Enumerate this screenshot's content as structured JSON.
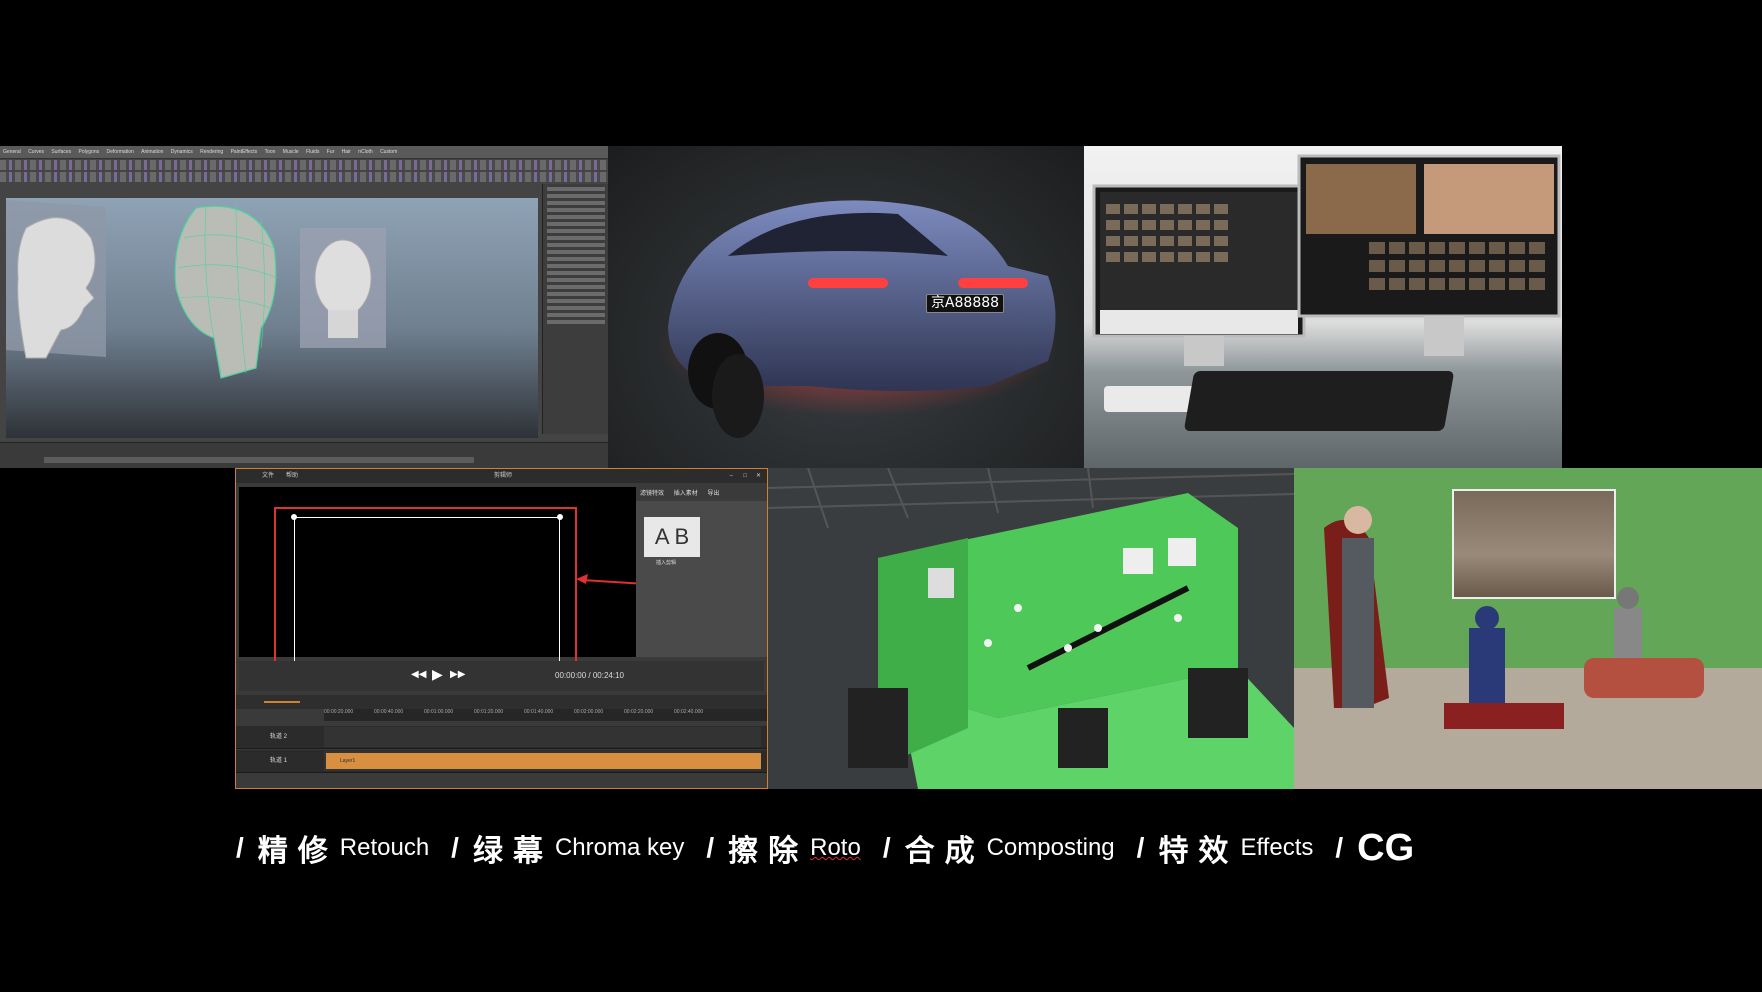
{
  "tiles": {
    "modeling": {
      "menubar": [
        "General",
        "Curves",
        "Surfaces",
        "Polygons",
        "Deformation",
        "Animation",
        "Dynamics",
        "Rendering",
        "PaintEffects",
        "Toon",
        "Muscle",
        "Fluids",
        "Fur",
        "Hair",
        "nCloth",
        "Custom"
      ]
    },
    "car": {
      "plate": "京A88888"
    },
    "editor": {
      "menu": [
        "文件",
        "帮助"
      ],
      "window_title": "剪辑师",
      "tabs": [
        "滤镜特效",
        "插入素材",
        "导出"
      ],
      "ab_label": "A B",
      "ab_caption": "插入剪辑",
      "timecode": "00:00:00 / 00:24:10",
      "ruler": [
        "00:00:20.000",
        "00:00:40.000",
        "00:01:00.000",
        "00:01:20.000",
        "00:01:40.000",
        "00:02:00.000",
        "00:02:20.000",
        "00:02:40.000"
      ],
      "tracks": [
        {
          "name": "轨道 2"
        },
        {
          "name": "轨道 1",
          "clip": "Layer1"
        }
      ]
    }
  },
  "caption": {
    "items": [
      {
        "sep": "/",
        "zh": "精修",
        "en": "Retouch"
      },
      {
        "sep": "/",
        "zh": "绿幕",
        "en": "Chroma key"
      },
      {
        "sep": "/",
        "zh": "擦除",
        "en": "Roto"
      },
      {
        "sep": "/",
        "zh": "合成",
        "en": "Composting"
      },
      {
        "sep": "/",
        "zh": "特效",
        "en": "Effects"
      }
    ],
    "final_sep": "/",
    "final": "CG"
  }
}
